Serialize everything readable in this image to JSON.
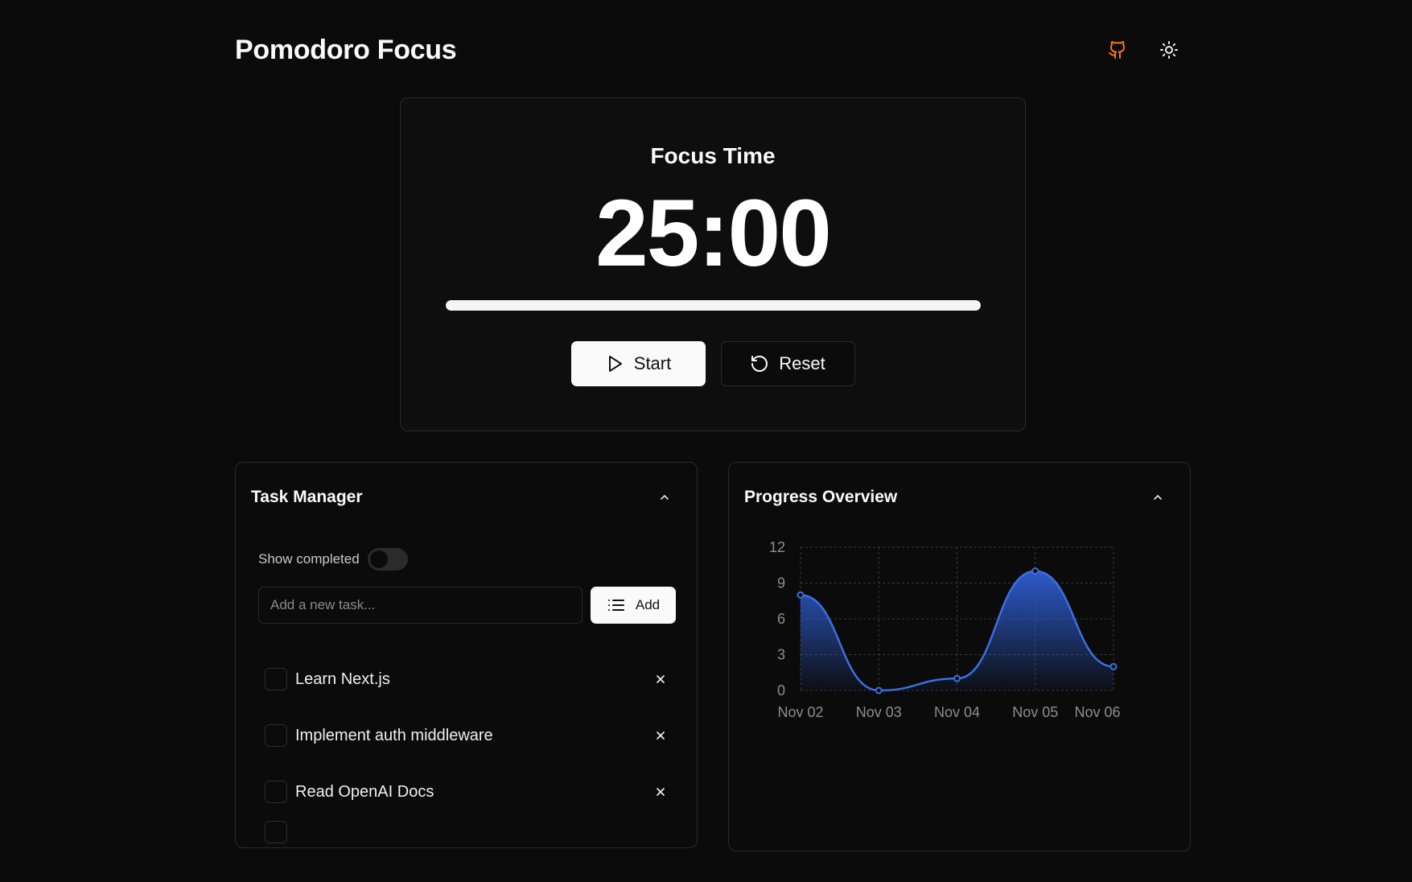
{
  "app": {
    "title": "Pomodoro Focus"
  },
  "header": {
    "github_icon": "github-icon",
    "theme_icon": "sun-icon",
    "github_color": "#f97316"
  },
  "timer": {
    "mode_label": "Focus Time",
    "display": "25:00",
    "progress_fraction": 1.0,
    "start_label": "Start",
    "reset_label": "Reset"
  },
  "tasks": {
    "title": "Task Manager",
    "show_completed_label": "Show completed",
    "show_completed_on": false,
    "input_placeholder": "Add a new task...",
    "input_value": "",
    "add_label": "Add",
    "items": [
      {
        "text": "Learn Next.js",
        "done": false
      },
      {
        "text": "Implement auth middleware",
        "done": false
      },
      {
        "text": "Read OpenAI Docs",
        "done": false
      }
    ]
  },
  "progress": {
    "title": "Progress Overview"
  },
  "chart_data": {
    "type": "area",
    "categories": [
      "Nov 02",
      "Nov 03",
      "Nov 04",
      "Nov 05",
      "Nov 06"
    ],
    "values": [
      8,
      0,
      1,
      10,
      2
    ],
    "yticks": [
      0,
      3,
      6,
      9,
      12
    ],
    "ylim": [
      0,
      12
    ],
    "grid": true,
    "line_color": "#3b6fe0",
    "fill_color": "#2f5fd6"
  }
}
